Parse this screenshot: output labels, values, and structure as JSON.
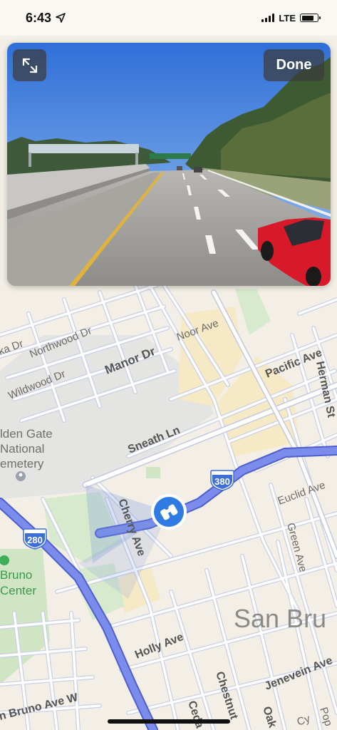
{
  "status_bar": {
    "time": "6:43",
    "network": "LTE",
    "signal_bars": 4,
    "battery_level": 0.8,
    "location_icon": "location-arrow-icon"
  },
  "look_around": {
    "expand_icon": "expand-arrows-icon",
    "done_label": "Done"
  },
  "map": {
    "streets": {
      "northwood": "Northwood Dr",
      "wildwood": "Wildwood Dr",
      "manor": "Manor Dr",
      "noor": "Noor Ave",
      "pacific": "Pacific Ave",
      "herman": "Herman St",
      "sneath": "Sneath Ln",
      "cherry": "Cherry Ave",
      "euclid": "Euclid Ave",
      "green": "Green Ave",
      "holly": "Holly Ave",
      "jenevein": "Jenevein Ave",
      "chestnut": "Chestnut",
      "san_bruno_w": "n Bruno Ave W",
      "ka": "ka Dr",
      "ceda": "Ceda",
      "oak": "Oak",
      "pop": "Pop",
      "cy": "Cy"
    },
    "cemetery": [
      "lden Gate",
      "National",
      "emetery"
    ],
    "bruno_center": [
      "Bruno",
      "Center"
    ],
    "city": "San Bru",
    "shields": {
      "i380": "380",
      "i280": "280"
    },
    "colors": {
      "land": "#f3efe6",
      "street": "#ffffff",
      "street_outline": "#c9cfe6",
      "highway": "#6f80e6",
      "highway_outline": "#4e5fcc",
      "park": "#d3e8c8",
      "campus": "#f6e8c3",
      "cemetery_area": "#e2e2e2",
      "shield": "#3e6fd8"
    }
  }
}
